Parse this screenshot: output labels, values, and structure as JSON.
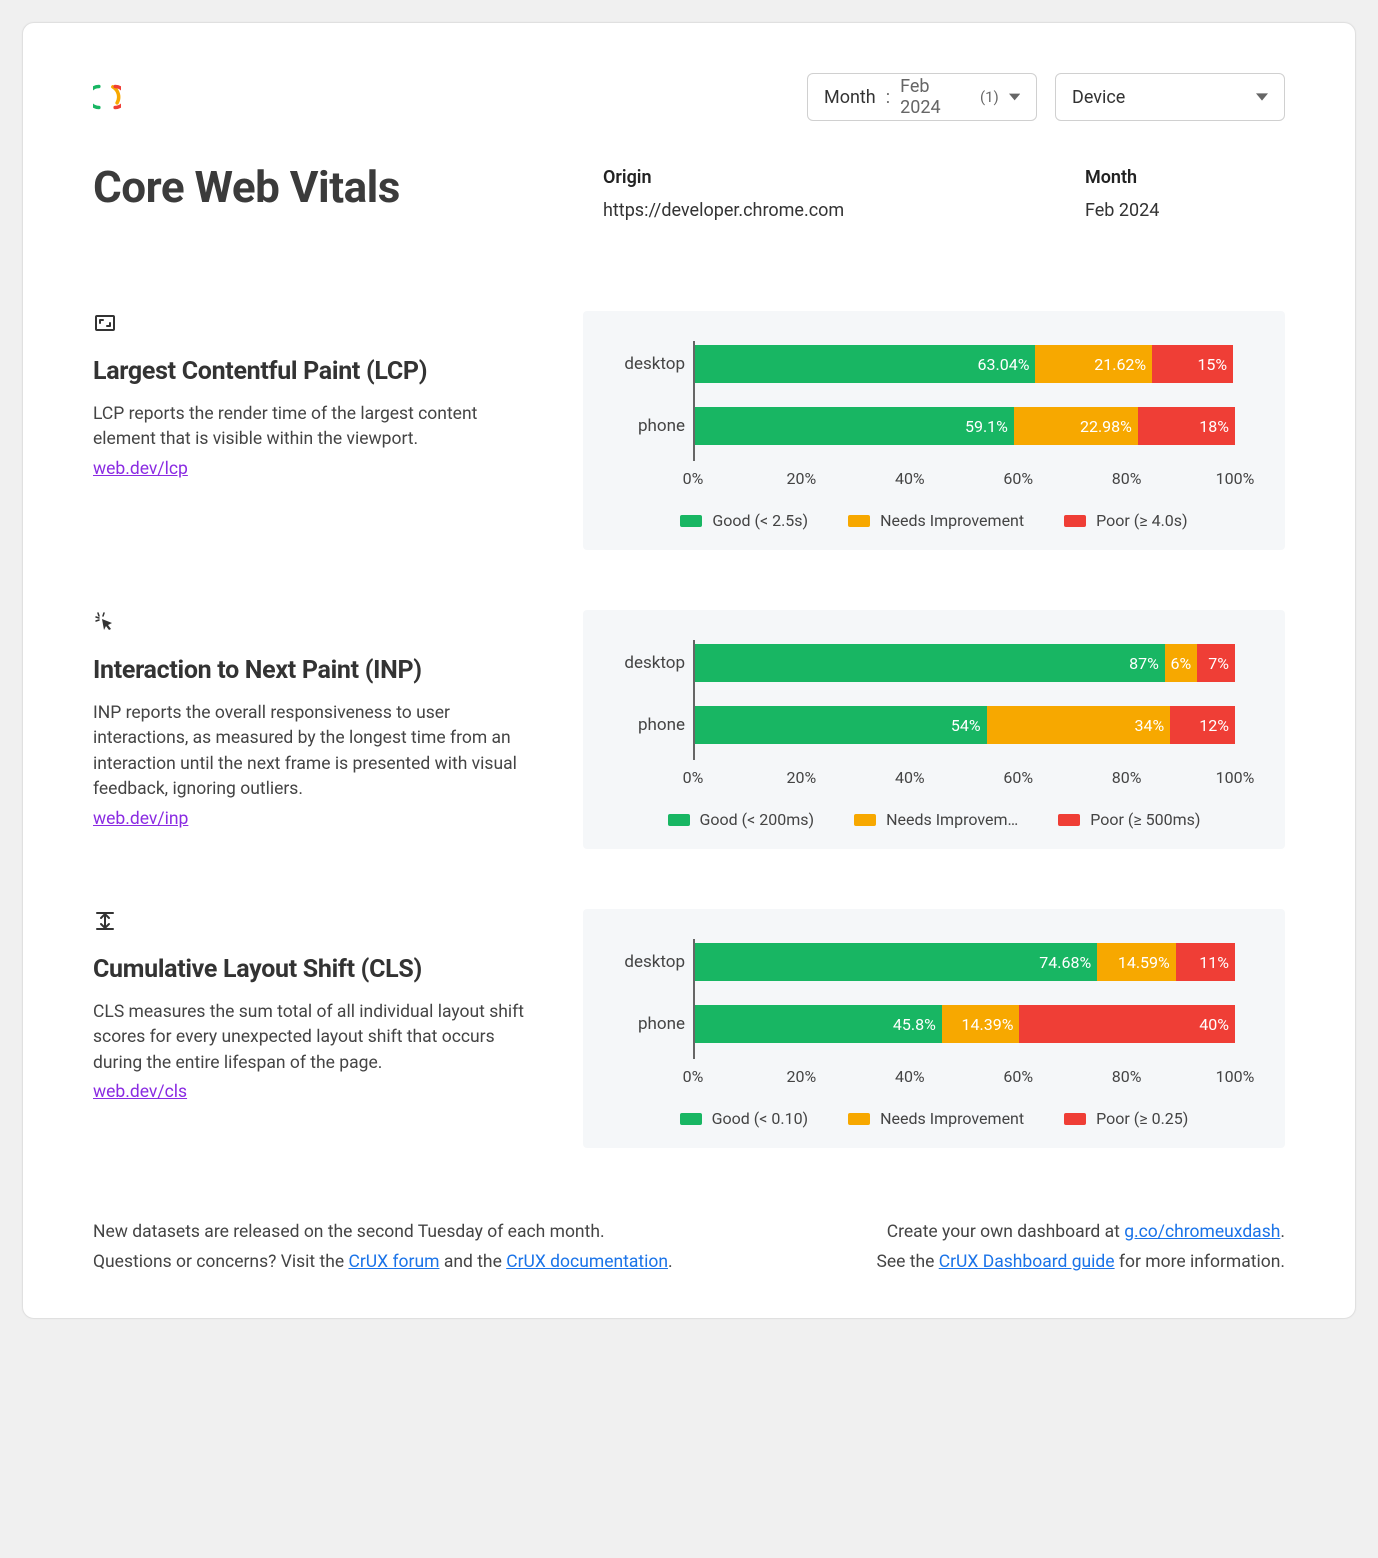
{
  "filters": {
    "month": {
      "label": "Month",
      "value": "Feb 2024",
      "count": "(1)"
    },
    "device": {
      "label": "Device"
    }
  },
  "header": {
    "title": "Core Web Vitals",
    "origin_label": "Origin",
    "origin": "https://developer.chrome.com",
    "month_label": "Month",
    "month": "Feb 2024"
  },
  "axis_ticks": [
    "0%",
    "20%",
    "40%",
    "60%",
    "80%",
    "100%"
  ],
  "colors": {
    "good": "#18b663",
    "ni": "#f7a800",
    "poor": "#ef3e36"
  },
  "metrics": [
    {
      "id": "lcp",
      "icon": "aspect-ratio-icon",
      "title": "Largest Contentful Paint (LCP)",
      "desc": "LCP reports the render time of the largest content element that is visible within the viewport.",
      "link_text": "web.dev/lcp",
      "legend": {
        "good": "Good (< 2.5s)",
        "ni": "Needs Improvement",
        "poor": "Poor (≥ 4.0s)",
        "ni_trunc": false
      },
      "rows": [
        {
          "label": "desktop",
          "good": 63.04,
          "ni": 21.62,
          "poor": 15,
          "labels": {
            "good": "63.04%",
            "ni": "21.62%",
            "poor": "15%"
          }
        },
        {
          "label": "phone",
          "good": 59.1,
          "ni": 22.98,
          "poor": 18,
          "labels": {
            "good": "59.1%",
            "ni": "22.98%",
            "poor": "18%"
          }
        }
      ]
    },
    {
      "id": "inp",
      "icon": "cursor-click-icon",
      "title": "Interaction to Next Paint (INP)",
      "desc": "INP reports the overall responsiveness to user interactions, as measured by the longest time from an interaction until the next frame is presented with visual feedback, ignoring outliers.",
      "link_text": "web.dev/inp",
      "legend": {
        "good": "Good (< 200ms)",
        "ni": "Needs Improvem…",
        "poor": "Poor (≥ 500ms)",
        "ni_trunc": true
      },
      "rows": [
        {
          "label": "desktop",
          "good": 87,
          "ni": 6,
          "poor": 7,
          "labels": {
            "good": "87%",
            "ni": "6%",
            "poor": "7%"
          }
        },
        {
          "label": "phone",
          "good": 54,
          "ni": 34,
          "poor": 12,
          "labels": {
            "good": "54%",
            "ni": "34%",
            "poor": "12%"
          }
        }
      ]
    },
    {
      "id": "cls",
      "icon": "layout-shift-icon",
      "title": "Cumulative Layout Shift (CLS)",
      "desc": "CLS measures the sum total of all individual layout shift scores for every unexpected layout shift that occurs during the entire lifespan of the page.",
      "link_text": "web.dev/cls",
      "legend": {
        "good": "Good (< 0.10)",
        "ni": "Needs Improvement",
        "poor": "Poor (≥ 0.25)",
        "ni_trunc": false
      },
      "rows": [
        {
          "label": "desktop",
          "good": 74.68,
          "ni": 14.59,
          "poor": 11,
          "labels": {
            "good": "74.68%",
            "ni": "14.59%",
            "poor": "11%"
          }
        },
        {
          "label": "phone",
          "good": 45.8,
          "ni": 14.39,
          "poor": 40,
          "labels": {
            "good": "45.8%",
            "ni": "14.39%",
            "poor": "40%"
          }
        }
      ]
    }
  ],
  "footer": {
    "left": {
      "line1": "New datasets are released on the second Tuesday of each month.",
      "line2_a": "Questions or concerns? Visit the",
      "link1": "CrUX forum",
      "line2_b": "and the",
      "link2": "CrUX documentation",
      "period": "."
    },
    "right": {
      "line1_a": "Create your own dashboard at",
      "link1": "g.co/chromeuxdash",
      "period": ".",
      "line2_a": "See the",
      "link2": "CrUX Dashboard guide",
      "line2_b": "for more information."
    }
  },
  "chart_data": [
    {
      "type": "bar",
      "title": "Largest Contentful Paint (LCP)",
      "orientation": "horizontal-stacked",
      "categories": [
        "desktop",
        "phone"
      ],
      "series": [
        {
          "name": "Good (< 2.5s)",
          "values": [
            63.04,
            59.1
          ]
        },
        {
          "name": "Needs Improvement",
          "values": [
            21.62,
            22.98
          ]
        },
        {
          "name": "Poor (≥ 4.0s)",
          "values": [
            15,
            18
          ]
        }
      ],
      "xlabel": "",
      "ylabel": "",
      "xlim": [
        0,
        100
      ],
      "x_ticks": [
        0,
        20,
        40,
        60,
        80,
        100
      ],
      "unit": "%"
    },
    {
      "type": "bar",
      "title": "Interaction to Next Paint (INP)",
      "orientation": "horizontal-stacked",
      "categories": [
        "desktop",
        "phone"
      ],
      "series": [
        {
          "name": "Good (< 200ms)",
          "values": [
            87,
            54
          ]
        },
        {
          "name": "Needs Improvement",
          "values": [
            6,
            34
          ]
        },
        {
          "name": "Poor (≥ 500ms)",
          "values": [
            7,
            12
          ]
        }
      ],
      "xlabel": "",
      "ylabel": "",
      "xlim": [
        0,
        100
      ],
      "x_ticks": [
        0,
        20,
        40,
        60,
        80,
        100
      ],
      "unit": "%"
    },
    {
      "type": "bar",
      "title": "Cumulative Layout Shift (CLS)",
      "orientation": "horizontal-stacked",
      "categories": [
        "desktop",
        "phone"
      ],
      "series": [
        {
          "name": "Good (< 0.10)",
          "values": [
            74.68,
            45.8
          ]
        },
        {
          "name": "Needs Improvement",
          "values": [
            14.59,
            14.39
          ]
        },
        {
          "name": "Poor (≥ 0.25)",
          "values": [
            11,
            40
          ]
        }
      ],
      "xlabel": "",
      "ylabel": "",
      "xlim": [
        0,
        100
      ],
      "x_ticks": [
        0,
        20,
        40,
        60,
        80,
        100
      ],
      "unit": "%"
    }
  ]
}
